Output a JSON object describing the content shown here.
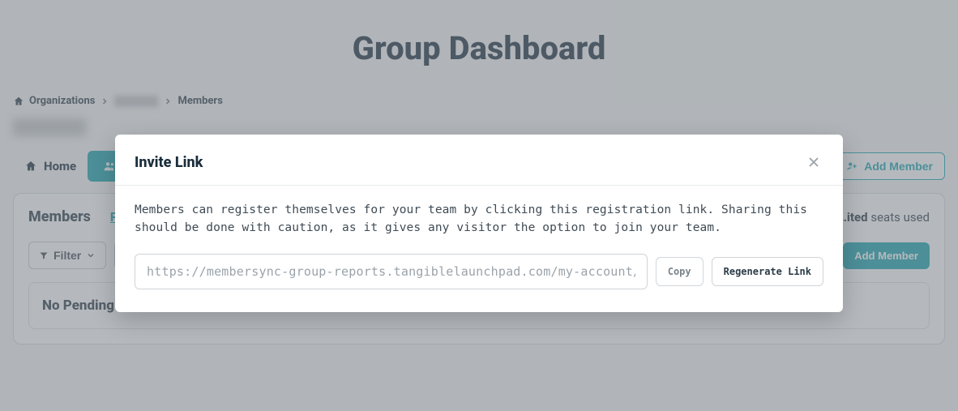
{
  "page_title": "Group Dashboard",
  "breadcrumb": {
    "root": "Organizations",
    "current": "Members"
  },
  "tabs": {
    "home": "Home",
    "members": "Members"
  },
  "header_actions": {
    "add_member": "Add Member"
  },
  "panel": {
    "title": "Members",
    "pending_link": "P",
    "seats_prefix": "",
    "seats_count_label": "…ited",
    "seats_suffix": " seats used",
    "filter_label": "Filter",
    "invite_link_label": "",
    "add_member_label": "Add Member",
    "no_pending": "No Pending Invites"
  },
  "modal": {
    "title": "Invite Link",
    "description": "Members can register themselves for your team by clicking this registration link. Sharing this should be done with caution, as it gives any visitor the option to join your team.",
    "link_value": "https://membersync-group-reports.tangiblelaunchpad.com/my-account/join-tea",
    "copy_label": "Copy",
    "regenerate_label": "Regenerate Link"
  }
}
